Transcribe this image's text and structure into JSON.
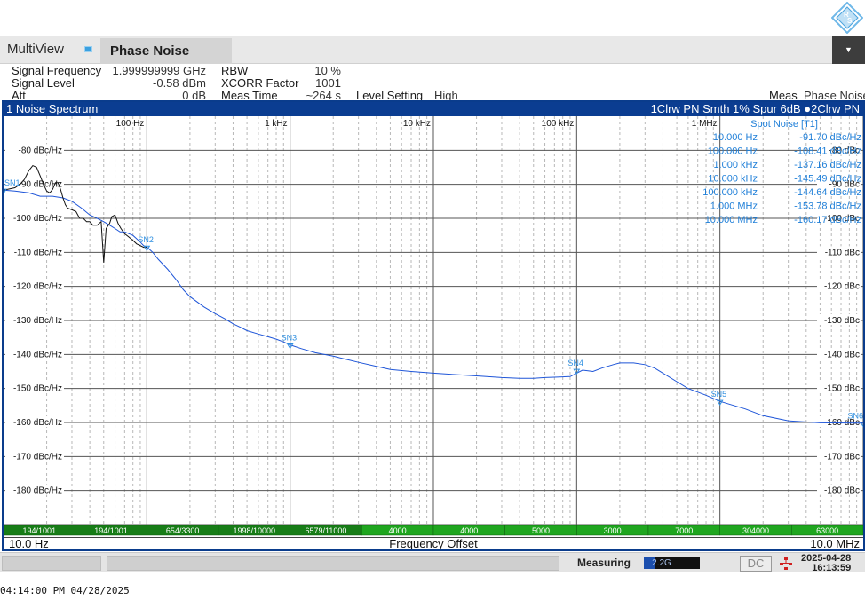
{
  "logo": {
    "icon": "rohde-schwarz-logo-icon"
  },
  "tabs": {
    "multiview": "MultiView",
    "active": "Phase Noise",
    "dropdown_icon": "chevron-down-icon"
  },
  "settings": {
    "signal_frequency_label": "Signal Frequency",
    "signal_frequency_value": "1.999999999 GHz",
    "signal_level_label": "Signal Level",
    "signal_level_value": "-0.58 dBm",
    "att_label": "Att",
    "att_value": "0 dB",
    "rbw_label": "RBW",
    "rbw_value": "10 %",
    "xcorr_label": "XCORR Factor",
    "xcorr_value": "1001",
    "meas_time_label": "Meas Time",
    "meas_time_value": "~264 s",
    "level_setting_label": "Level Setting",
    "level_setting_value": "High",
    "meas_label": "Meas",
    "meas_value": "Phase Noise"
  },
  "panel": {
    "title": "1 Noise Spectrum",
    "trace_info": "1Clrw PN Smth 1% Spur 6dB  ●2Clrw PN",
    "start_label": "10.0 Hz",
    "center_label": "Frequency Offset",
    "stop_label": "10.0 MHz",
    "spot_noise_title": "Spot Noise [T1]"
  },
  "colors": {
    "trace1": "#1e55d8",
    "trace2": "#111111",
    "marker": "#2f8fe0",
    "spot_text": "#1f7fd8",
    "panel_header": "#0b3d91",
    "count_bar": "#1fa61f",
    "count_bar_dark": "#177d17"
  },
  "spot_noise": [
    {
      "offset": "10.000 Hz",
      "value": "-91.70 dBc/Hz"
    },
    {
      "offset": "100.000 Hz",
      "value": "-108.41 dBc/Hz"
    },
    {
      "offset": "1.000 kHz",
      "value": "-137.16 dBc/Hz"
    },
    {
      "offset": "10.000 kHz",
      "value": "-145.49 dBc/Hz"
    },
    {
      "offset": "100.000 kHz",
      "value": "-144.64 dBc/Hz"
    },
    {
      "offset": "1.000 MHz",
      "value": "-153.78 dBc/Hz"
    },
    {
      "offset": "10.000 MHz",
      "value": "-160.17 dBc/Hz"
    }
  ],
  "averages": [
    "194/1001",
    "194/1001",
    "654/3300",
    "1998/10000",
    "6579/11000",
    "4000",
    "4000",
    "5000",
    "3000",
    "7000",
    "304000",
    "63000"
  ],
  "status": {
    "measuring_label": "Measuring",
    "progress_text": "2.2G",
    "progress_fraction": 0.21,
    "dc_label": "DC",
    "ext_icon": "external-reference-icon",
    "date": "2025-04-28",
    "time": "16:13:59"
  },
  "bottom_timestamp": "04:14:00 PM  04/28/2025",
  "chart_data": {
    "type": "line",
    "x_scale": "log",
    "xlim_hz": [
      10,
      10000000
    ],
    "ylim": [
      -190,
      -70
    ],
    "ylabel_unit": "dBc/Hz",
    "x_ticks": [
      "100 Hz",
      "1 kHz",
      "10 kHz",
      "100 kHz",
      "1 MHz"
    ],
    "x_tick_values": [
      100,
      1000,
      10000,
      100000,
      1000000
    ],
    "y_ticks_left": [
      "-80 dBc/Hz",
      "-90 dBc/Hz",
      "-100 dBc/Hz",
      "-110 dBc/Hz",
      "-120 dBc/Hz",
      "-130 dBc/Hz",
      "-140 dBc/Hz",
      "-150 dBc/Hz",
      "-160 dBc/Hz",
      "-170 dBc/Hz",
      "-180 dBc/Hz"
    ],
    "y_ticks_right": [
      "-80 dBc",
      "-90 dBc",
      "-100 dBc",
      "-110 dBc",
      "-120 dBc",
      "-130 dBc",
      "-140 dBc",
      "-150 dBc",
      "-160 dBc",
      "-170 dBc",
      "-180 dBc"
    ],
    "y_tick_values": [
      -80,
      -90,
      -100,
      -110,
      -120,
      -130,
      -140,
      -150,
      -160,
      -170,
      -180
    ],
    "grid": true,
    "series": [
      {
        "trace": "1",
        "x": [
          10,
          12,
          15,
          18,
          22,
          26,
          30,
          35,
          40,
          45,
          50,
          55,
          60,
          65,
          70,
          75,
          80,
          85,
          90,
          95,
          100,
          110,
          120,
          140,
          160,
          180,
          200,
          250,
          300,
          350,
          400,
          450,
          500,
          600,
          700,
          800,
          900,
          1000,
          1200,
          1500,
          2000,
          2500,
          3000,
          4000,
          5000,
          7000,
          10000,
          15000,
          20000,
          30000,
          40000,
          50000,
          60000,
          70000,
          80000,
          90000,
          100000,
          110000,
          120000,
          130000,
          150000,
          180000,
          200000,
          250000,
          300000,
          350000,
          400000,
          500000,
          600000,
          800000,
          1000000,
          1500000,
          2000000,
          3000000,
          5000000,
          10000000
        ],
        "y": [
          -91.7,
          -92,
          -92.5,
          -93.5,
          -93.5,
          -94,
          -95,
          -97,
          -99,
          -100,
          -101,
          -102,
          -103,
          -104,
          -104,
          -104.5,
          -105,
          -106,
          -107,
          -108,
          -108.4,
          -110,
          -112,
          -115,
          -118,
          -121,
          -123,
          -126,
          -128,
          -129.5,
          -131,
          -132,
          -133,
          -134,
          -134.8,
          -135.5,
          -136.3,
          -137.2,
          -138.3,
          -139.5,
          -140.5,
          -141.5,
          -142.3,
          -143.5,
          -144.4,
          -145,
          -145.5,
          -146,
          -146.3,
          -146.8,
          -147,
          -147,
          -146.8,
          -146.7,
          -146.6,
          -146.5,
          -145.5,
          -144.6,
          -144.8,
          -145,
          -144,
          -143,
          -142.5,
          -142.5,
          -143,
          -144,
          -145.5,
          -148,
          -150,
          -152,
          -153.8,
          -156,
          -158,
          -159.5,
          -160.1,
          -160.2
        ]
      },
      {
        "trace": "2",
        "x": [
          10,
          12,
          13,
          14,
          15,
          16,
          17,
          18,
          19,
          20,
          21,
          22,
          23,
          24,
          25,
          26,
          27,
          28,
          30,
          32,
          34,
          36,
          38,
          40,
          42,
          45,
          48,
          50,
          52,
          55,
          57,
          60,
          63,
          66,
          70,
          75,
          80,
          85,
          90,
          95,
          100
        ],
        "y": [
          -91.7,
          -91,
          -90,
          -88.5,
          -86,
          -84.5,
          -85,
          -87.5,
          -90,
          -92,
          -92.5,
          -91.5,
          -89.5,
          -89.5,
          -91.5,
          -94,
          -96,
          -97,
          -97.5,
          -98,
          -100,
          -100,
          -101,
          -101,
          -102,
          -102,
          -101,
          -113,
          -103,
          -101.5,
          -99.5,
          -99,
          -101.5,
          -103,
          -104.5,
          -105.5,
          -106.5,
          -107.5,
          -108,
          -108.5,
          -108.5
        ]
      }
    ],
    "markers": [
      {
        "name": "SN1",
        "x": 10,
        "y": -91.7
      },
      {
        "name": "SN2",
        "x": 100,
        "y": -108.41
      },
      {
        "name": "SN3",
        "x": 1000,
        "y": -137.16
      },
      {
        "name": "SN4",
        "x": 100000,
        "y": -144.64
      },
      {
        "name": "SN5",
        "x": 1000000,
        "y": -153.78
      },
      {
        "name": "SN6",
        "x": 10000000,
        "y": -160.17
      }
    ]
  }
}
